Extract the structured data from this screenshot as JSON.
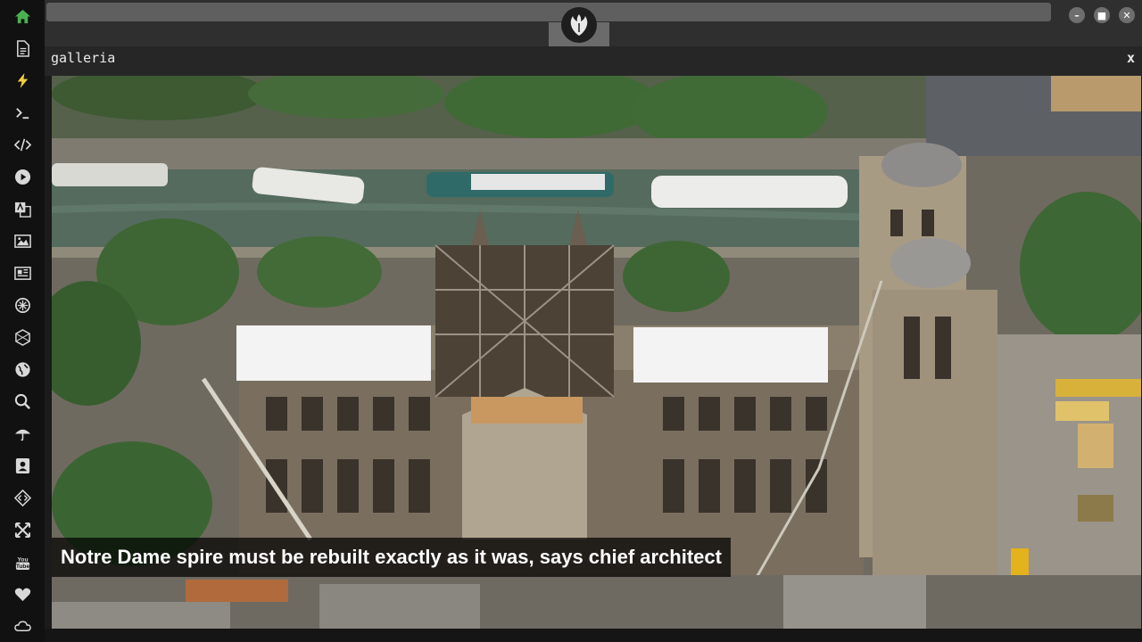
{
  "sidebar": {
    "items": [
      {
        "name": "home-icon",
        "active": true
      },
      {
        "name": "document-icon"
      },
      {
        "name": "lightning-icon"
      },
      {
        "name": "terminal-icon"
      },
      {
        "name": "code-icon"
      },
      {
        "name": "play-icon"
      },
      {
        "name": "translate-icon"
      },
      {
        "name": "image-icon"
      },
      {
        "name": "news-icon"
      },
      {
        "name": "settings-wheel-icon"
      },
      {
        "name": "hexagon-icon"
      },
      {
        "name": "globe-icon"
      },
      {
        "name": "search-icon"
      },
      {
        "name": "umbrella-icon"
      },
      {
        "name": "contact-card-icon"
      },
      {
        "name": "developer-icon"
      },
      {
        "name": "expand-icon"
      },
      {
        "name": "youtube-icon"
      },
      {
        "name": "heart-icon"
      },
      {
        "name": "cloud-icon"
      }
    ],
    "active_color": "#4caf50",
    "accent_color": "#f4d03f"
  },
  "window": {
    "logo_icon": "rebel-alliance-icon",
    "minimize_icon": "minimize-icon",
    "maximize_icon": "maximize-icon",
    "close_icon": "close-icon"
  },
  "panel": {
    "title": "galleria",
    "close_label": "x"
  },
  "gallery": {
    "caption": "Notre Dame spire must be rebuilt exactly as it was, says chief architect"
  }
}
